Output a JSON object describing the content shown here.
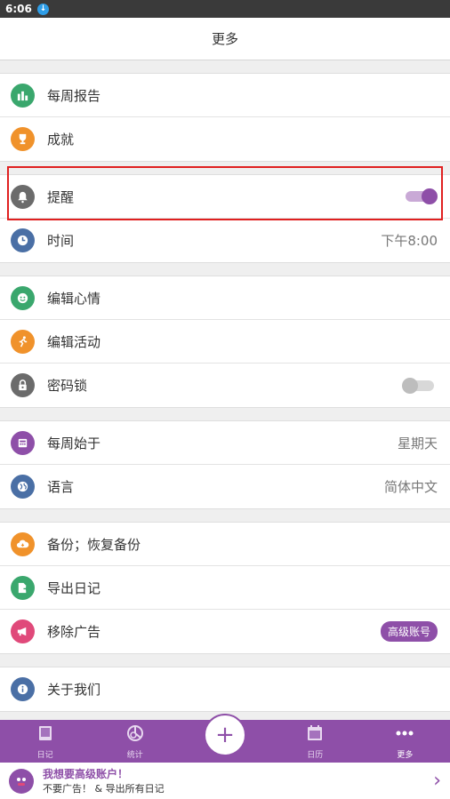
{
  "status": {
    "time": "6:06"
  },
  "header": {
    "title": "更多"
  },
  "groups": [
    {
      "items": [
        {
          "label": "每周报告",
          "icon": "bar-chart-icon",
          "color": "#3aa76d"
        },
        {
          "label": "成就",
          "icon": "trophy-icon",
          "color": "#f0922b"
        }
      ]
    },
    {
      "items": [
        {
          "label": "提醒",
          "icon": "bell-icon",
          "color": "#6b6b6b",
          "toggle": true
        },
        {
          "label": "时间",
          "icon": "clock-icon",
          "color": "#4a6fa5",
          "value": "下午8:00"
        }
      ]
    },
    {
      "items": [
        {
          "label": "编辑心情",
          "icon": "smile-icon",
          "color": "#3aa76d"
        },
        {
          "label": "编辑活动",
          "icon": "run-icon",
          "color": "#f0922b"
        },
        {
          "label": "密码锁",
          "icon": "lock-icon",
          "color": "#6b6b6b",
          "toggle": false
        }
      ]
    },
    {
      "items": [
        {
          "label": "每周始于",
          "icon": "calendar-grid-icon",
          "color": "#8e4fa8",
          "value": "星期天"
        },
        {
          "label": "语言",
          "icon": "globe-icon",
          "color": "#4a6fa5",
          "value": "简体中文"
        }
      ]
    },
    {
      "items": [
        {
          "label": "备份；恢复备份",
          "icon": "cloud-icon",
          "color": "#f0922b"
        },
        {
          "label": "导出日记",
          "icon": "export-icon",
          "color": "#3aa76d"
        },
        {
          "label": "移除广告",
          "icon": "megaphone-icon",
          "color": "#e0497a",
          "badge": "高级账号"
        }
      ]
    },
    {
      "items": [
        {
          "label": "关于我们",
          "icon": "info-icon",
          "color": "#4a6fa5"
        }
      ]
    }
  ],
  "tabs": [
    {
      "label": "日记",
      "icon": "book-icon"
    },
    {
      "label": "统计",
      "icon": "pie-chart-icon"
    },
    {
      "label": "日历",
      "icon": "calendar-icon"
    },
    {
      "label": "更多",
      "icon": "more-dots-icon",
      "active": true
    }
  ],
  "fab": {
    "label": "+"
  },
  "ad": {
    "title": "我想要高级账户！",
    "subtitle": "不要广告！ & 导出所有日记"
  }
}
